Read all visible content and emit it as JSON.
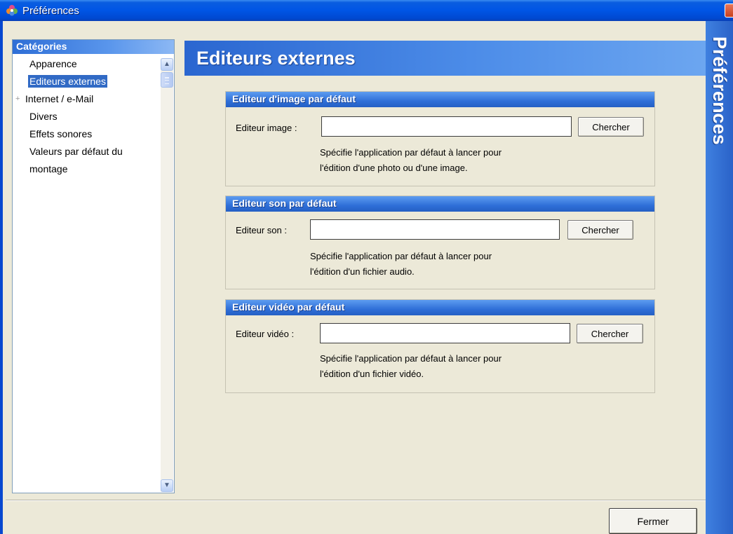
{
  "window": {
    "title": "Préférences"
  },
  "sidebar": {
    "header": "Catégories",
    "items": [
      {
        "label": "Apparence",
        "selected": false
      },
      {
        "label": "Editeurs externes",
        "selected": true
      },
      {
        "label": "Internet / e-Mail",
        "expandable": true
      },
      {
        "label": "Divers"
      },
      {
        "label": "Effets sonores"
      },
      {
        "label": "Valeurs par défaut du montage"
      }
    ]
  },
  "main": {
    "title": "Editeurs externes",
    "banner": "Préférences",
    "groups": [
      {
        "header": "Editeur d'image par défaut",
        "field_label": "Editeur image :",
        "value": "",
        "button": "Chercher",
        "desc_line1": "Spécifie l'application par défaut à lancer pour",
        "desc_line2": "l'édition d'une photo ou d'une image."
      },
      {
        "header": "Editeur son par défaut",
        "field_label": "Editeur son :",
        "value": "",
        "button": "Chercher",
        "desc_line1": "Spécifie l'application par défaut à lancer pour",
        "desc_line2": "l'édition d'un fichier audio."
      },
      {
        "header": "Editeur vidéo par défaut",
        "field_label": "Editeur vidéo :",
        "value": "",
        "button": "Chercher",
        "desc_line1": "Spécifie l'application par défaut à lancer pour",
        "desc_line2": "l'édition d'un fichier vidéo."
      }
    ]
  },
  "footer": {
    "close_label": "Fermer"
  },
  "colors": {
    "titlebar": "#0055e5",
    "selection": "#316ac5",
    "panel_bg": "#ece9d8"
  },
  "icons": {
    "app": "flower-icon",
    "close": "close-icon",
    "scroll_up": "chevron-up-icon",
    "scroll_down": "chevron-down-icon",
    "expander": "plus-icon"
  }
}
